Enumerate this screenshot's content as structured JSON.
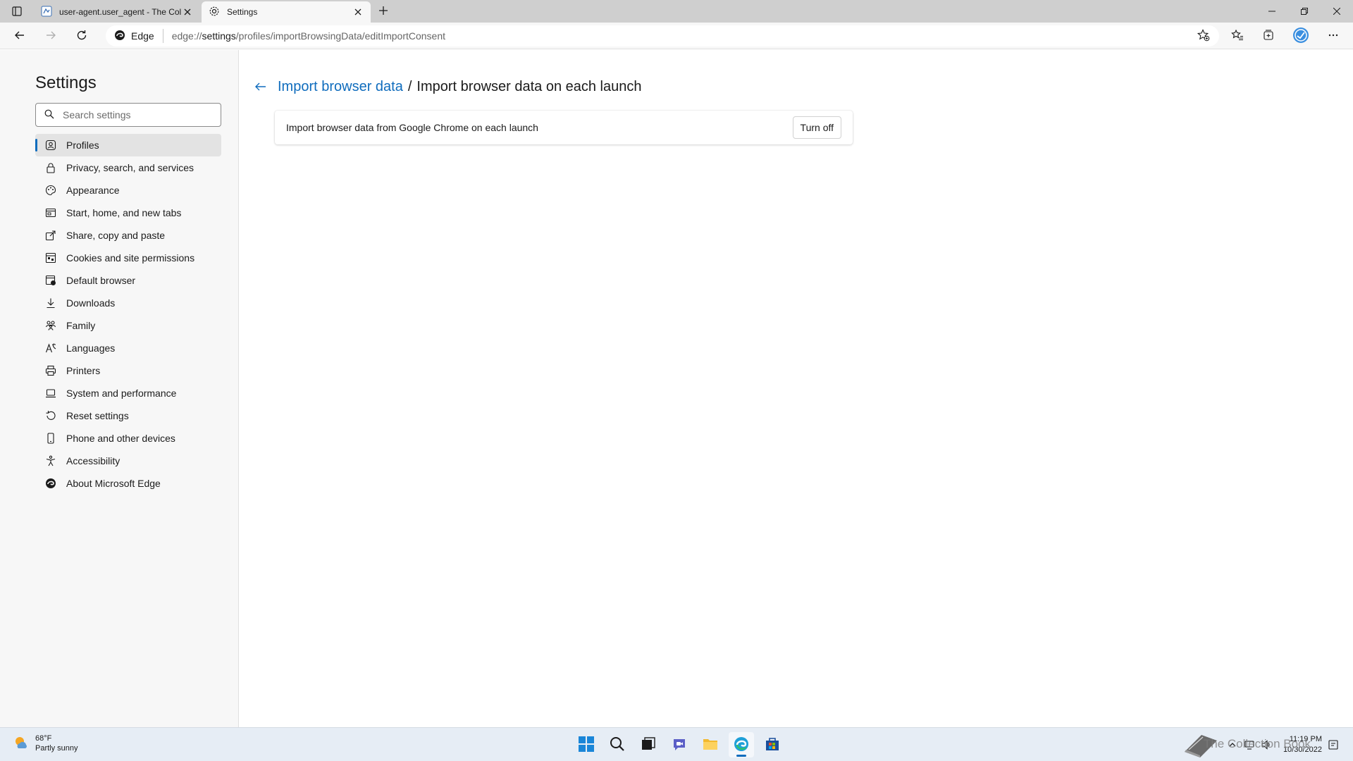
{
  "tabs": [
    {
      "title": "user-agent.user_agent - The Coll",
      "icon": "tab-favicon-icon",
      "close_icon": "close-icon"
    },
    {
      "title": "Settings",
      "icon": "gear-icon",
      "close_icon": "close-icon"
    }
  ],
  "toolbar": {
    "site_chip_label": "Edge",
    "url_prefix": "edge://",
    "url_host": "settings",
    "url_path": "/profiles/importBrowsingData/editImportConsent"
  },
  "sidebar": {
    "title": "Settings",
    "search_placeholder": "Search settings",
    "items": [
      {
        "label": "Profiles",
        "icon": "profile-icon",
        "active": true
      },
      {
        "label": "Privacy, search, and services",
        "icon": "lock-icon"
      },
      {
        "label": "Appearance",
        "icon": "palette-icon"
      },
      {
        "label": "Start, home, and new tabs",
        "icon": "home-tab-icon"
      },
      {
        "label": "Share, copy and paste",
        "icon": "share-icon"
      },
      {
        "label": "Cookies and site permissions",
        "icon": "cookies-icon"
      },
      {
        "label": "Default browser",
        "icon": "default-browser-icon"
      },
      {
        "label": "Downloads",
        "icon": "download-icon"
      },
      {
        "label": "Family",
        "icon": "family-icon"
      },
      {
        "label": "Languages",
        "icon": "languages-icon"
      },
      {
        "label": "Printers",
        "icon": "printer-icon"
      },
      {
        "label": "System and performance",
        "icon": "laptop-icon"
      },
      {
        "label": "Reset settings",
        "icon": "reset-icon"
      },
      {
        "label": "Phone and other devices",
        "icon": "phone-icon"
      },
      {
        "label": "Accessibility",
        "icon": "accessibility-icon"
      },
      {
        "label": "About Microsoft Edge",
        "icon": "edge-logo-icon"
      }
    ]
  },
  "main": {
    "breadcrumb_link": "Import browser data",
    "breadcrumb_separator": "/",
    "breadcrumb_current": "Import browser data on each launch",
    "card_text": "Import browser data from Google Chrome on each launch",
    "turn_off_label": "Turn off"
  },
  "taskbar": {
    "weather_temp": "68°F",
    "weather_desc": "Partly sunny",
    "time": "11:19 PM",
    "date": "10/30/2022",
    "watermark": "The Collection Book"
  },
  "colors": {
    "accent": "#0f6cbd",
    "sidebar_bg": "#f7f7f7",
    "tabstrip_bg": "#cfcfcf",
    "taskbar_bg": "#e6edf5"
  }
}
